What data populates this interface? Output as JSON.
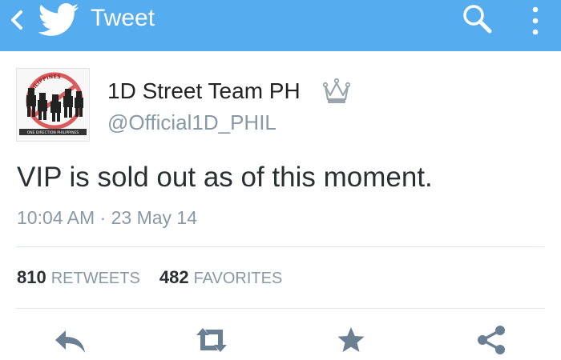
{
  "app_bar": {
    "title": "Tweet",
    "icons": [
      "back-icon",
      "twitter-bird-icon",
      "search-icon",
      "overflow-menu-icon"
    ],
    "background": "#55acee"
  },
  "tweet": {
    "display_name": "1D Street Team PH",
    "handle": "@Official1D_PHIL",
    "avatar_texts": {
      "top": "PHILIPPINES",
      "bottom": "ONE DIRECTION PHILIPPINES"
    },
    "text": "VIP is sold out as of this moment.",
    "timestamp": "10:04 AM · 23 May 14"
  },
  "stats": {
    "retweets_count": "810",
    "retweets_label": "RETWEETS",
    "favorites_count": "482",
    "favorites_label": "FAVORITES"
  },
  "actions": [
    "reply-icon",
    "retweet-icon",
    "favorite-icon",
    "share-icon"
  ],
  "colors": {
    "text_primary": "#292f33",
    "text_secondary": "#8899a6",
    "action_icons": "#6b7f92",
    "divider": "#e1e8ed"
  }
}
